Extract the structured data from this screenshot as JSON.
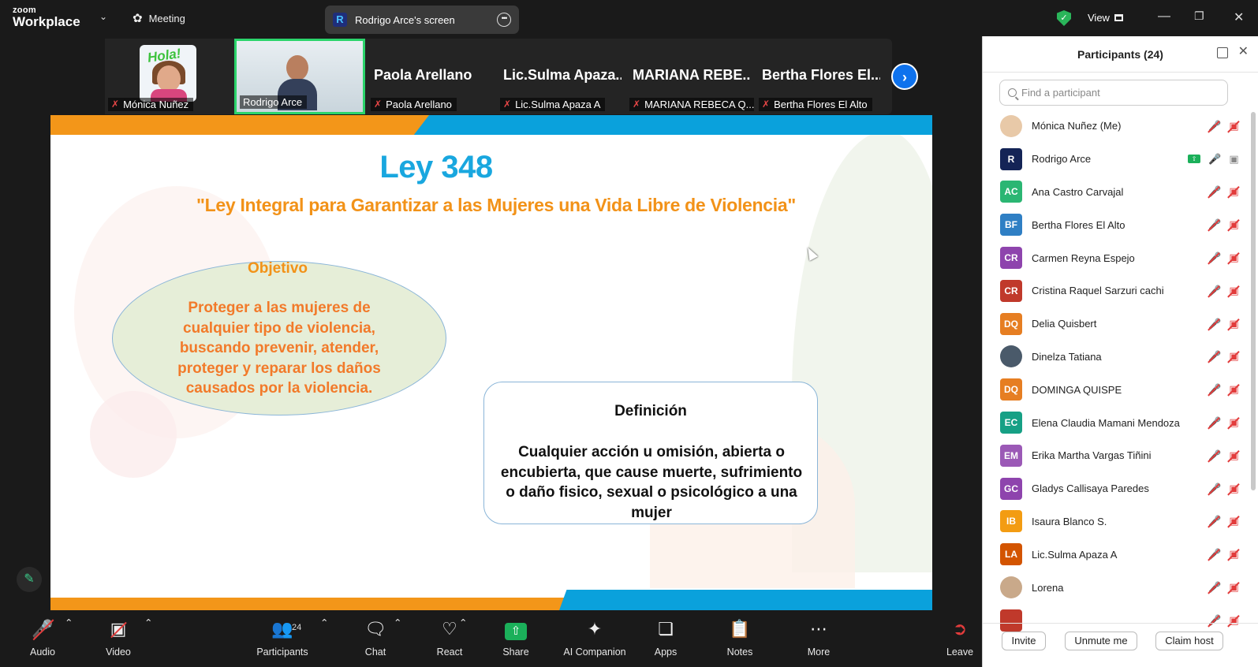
{
  "topbar": {
    "brand_small": "zoom",
    "brand_big": "Workplace",
    "meeting_label": "Meeting",
    "screen_share_label": "Rodrigo Arce's screen",
    "view_label": "View"
  },
  "strip": {
    "tiles": [
      {
        "label": "Mónica Nuñez"
      },
      {
        "label": "Rodrigo Arce"
      },
      {
        "name": "Paola Arellano",
        "label": "Paola Arellano"
      },
      {
        "name": "Lic.Sulma  Apaza...",
        "label": "Lic.Sulma Apaza A"
      },
      {
        "name": "MARIANA  REBE...",
        "label": "MARIANA REBECA  Q..."
      },
      {
        "name": "Bertha  Flores  El...",
        "label": "Bertha Flores El Alto"
      }
    ],
    "avatar_text": "Hola!"
  },
  "slide": {
    "title": "Ley 348",
    "subtitle": "\"Ley Integral para Garantizar a las Mujeres una Vida Libre de Violencia\"",
    "objective_heading": "Objetivo",
    "objective_text": "Proteger a las mujeres de cualquier tipo de violencia, buscando prevenir, atender, proteger y reparar los daños causados por la violencia.",
    "definition_heading": "Definición",
    "definition_text": "Cualquier acción u omisión, abierta o encubierta, que cause muerte, sufrimiento o daño fisico, sexual o psicológico a una mujer"
  },
  "toolbar": {
    "audio": "Audio",
    "video": "Video",
    "participants": "Participants",
    "participants_count": "24",
    "chat": "Chat",
    "react": "React",
    "share": "Share",
    "ai_companion": "AI Companion",
    "apps": "Apps",
    "notes": "Notes",
    "more": "More",
    "leave": "Leave"
  },
  "panel": {
    "title": "Participants (24)",
    "search_placeholder": "Find a participant",
    "participants": [
      {
        "name": "Mónica Nuñez (Me)",
        "initials": "",
        "color": "#e8c9a8",
        "photo": true
      },
      {
        "name": "Rodrigo Arce",
        "initials": "R",
        "color": "#142456",
        "photo": false,
        "host": true
      },
      {
        "name": "Ana Castro Carvajal",
        "initials": "AC",
        "color": "#2bb673"
      },
      {
        "name": "Bertha Flores El Alto",
        "initials": "BF",
        "color": "#2f7fc4"
      },
      {
        "name": "Carmen Reyna  Espejo",
        "initials": "CR",
        "color": "#8e44ad"
      },
      {
        "name": "Cristina Raquel Sarzuri cachi",
        "initials": "CR",
        "color": "#c0392b"
      },
      {
        "name": "Delia Quisbert",
        "initials": "DQ",
        "color": "#e67e22"
      },
      {
        "name": "Dinelza Tatiana",
        "initials": "",
        "color": "#4a5a6a",
        "photo": true
      },
      {
        "name": "DOMINGA QUISPE",
        "initials": "DQ",
        "color": "#e67e22"
      },
      {
        "name": "Elena Claudia Mamani Mendoza",
        "initials": "EC",
        "color": "#16a085"
      },
      {
        "name": "Erika Martha Vargas Tiñini",
        "initials": "EM",
        "color": "#9b59b6"
      },
      {
        "name": "Gladys Callisaya Paredes",
        "initials": "GC",
        "color": "#8e44ad"
      },
      {
        "name": "Isaura Blanco S.",
        "initials": "IB",
        "color": "#f39c12"
      },
      {
        "name": "Lic.Sulma Apaza A",
        "initials": "LA",
        "color": "#d35400"
      },
      {
        "name": "Lorena",
        "initials": "",
        "color": "#c9a98a",
        "photo": true
      },
      {
        "name": "",
        "initials": "",
        "color": "#c0392b"
      }
    ],
    "invite": "Invite",
    "unmute": "Unmute me",
    "claim_host": "Claim host"
  }
}
